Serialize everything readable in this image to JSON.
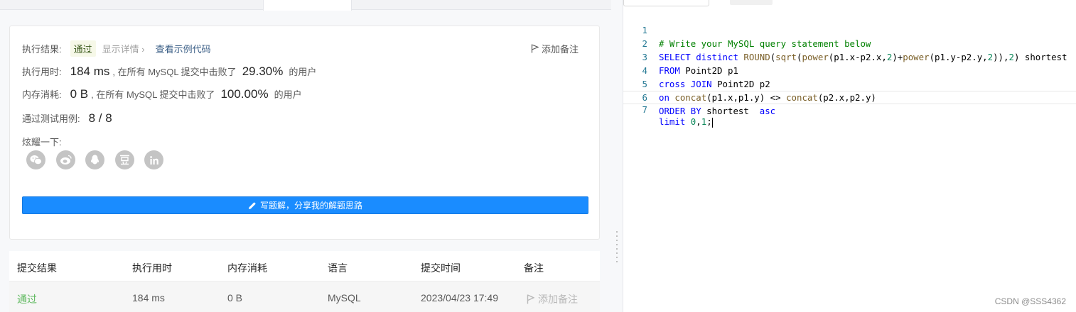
{
  "result": {
    "status_label": "执行结果:",
    "status_value": "通过",
    "show_details": "显示详情",
    "view_example": "查看示例代码",
    "add_note": "添加备注",
    "runtime_label": "执行用时:",
    "runtime_value": "184 ms",
    "runtime_text": ", 在所有 MySQL 提交中击败了",
    "runtime_percent": "29.30%",
    "runtime_suffix": "的用户",
    "memory_label": "内存消耗:",
    "memory_value": "0 B",
    "memory_text": ", 在所有 MySQL 提交中击败了",
    "memory_percent": "100.00%",
    "memory_suffix": "的用户",
    "tests_label": "通过测试用例:",
    "tests_value": "8 / 8",
    "share_label": "炫耀一下:",
    "share_icons": [
      "wechat-icon",
      "weibo-icon",
      "qq-icon",
      "douban-icon",
      "linkedin-icon"
    ],
    "write_solution": "写题解，分享我的解题思路"
  },
  "history": {
    "headers": [
      "提交结果",
      "执行用时",
      "内存消耗",
      "语言",
      "提交时间",
      "备注"
    ],
    "row": {
      "status": "通过",
      "runtime": "184 ms",
      "memory": "0 B",
      "language": "MySQL",
      "time": "2023/04/23 17:49",
      "note": "添加备注"
    }
  },
  "editor": {
    "lines": [
      {
        "n": "1",
        "text": "# Write your MySQL query statement below"
      },
      {
        "n": "2",
        "text": "SELECT distinct ROUND(sqrt(power(p1.x-p2.x,2)+power(p1.y-p2.y,2)),2) shortest"
      },
      {
        "n": "3",
        "text": "FROM Point2D p1"
      },
      {
        "n": "4",
        "text": "cross JOIN Point2D p2"
      },
      {
        "n": "5",
        "text": "on concat(p1.x,p1.y) <> concat(p2.x,p2.y)"
      },
      {
        "n": "6",
        "text": "ORDER BY shortest  asc"
      },
      {
        "n": "7",
        "text": "limit 0,1;"
      }
    ]
  },
  "watermark": "CSDN @SSS4362",
  "colors": {
    "primary_button": "#1a8cff",
    "pass_green": "#5cb85c",
    "link_blue": "#3a5e86",
    "keyword_blue": "#0000ff",
    "comment_green": "#008000",
    "number_green": "#098658"
  }
}
